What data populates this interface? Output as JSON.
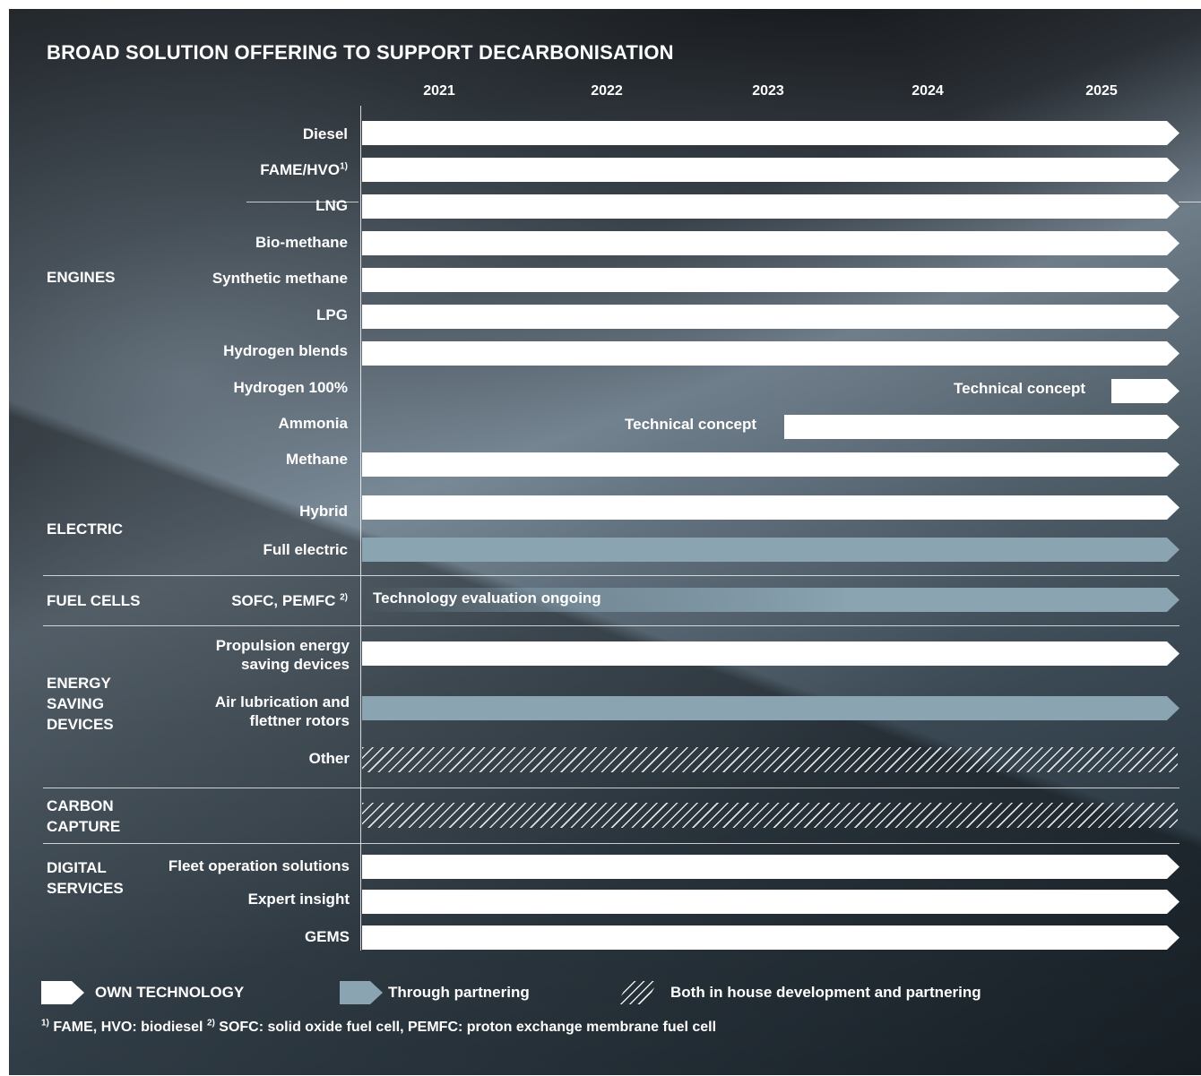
{
  "title": "BROAD SOLUTION OFFERING TO SUPPORT DECARBONISATION",
  "chart_data": {
    "type": "gantt",
    "title": "BROAD SOLUTION OFFERING TO SUPPORT DECARBONISATION",
    "x_axis": {
      "years": [
        "2021",
        "2022",
        "2023",
        "2024",
        "2025"
      ]
    },
    "categories": {
      "engines": "ENGINES",
      "electric": "ELECTRIC",
      "fuel_cells": "FUEL CELLS",
      "energy_saving": "ENERGY SAVING DEVICES",
      "carbon_capture": "CARBON CAPTURE",
      "digital": "DIGITAL SERVICES"
    },
    "rows": [
      {
        "group": "ENGINES",
        "label": "Diesel",
        "type": "own",
        "start": "2021",
        "end": "2025"
      },
      {
        "group": "ENGINES",
        "label": "FAME/HVO",
        "footnote": "1)",
        "type": "own",
        "start": "2021",
        "end": "2025"
      },
      {
        "group": "ENGINES",
        "label": "LNG",
        "type": "own",
        "start": "2021",
        "end": "2025"
      },
      {
        "group": "ENGINES",
        "label": "Bio-methane",
        "type": "own",
        "start": "2021",
        "end": "2025"
      },
      {
        "group": "ENGINES",
        "label": "Synthetic methane",
        "type": "own",
        "start": "2021",
        "end": "2025"
      },
      {
        "group": "ENGINES",
        "label": "LPG",
        "type": "own",
        "start": "2021",
        "end": "2025"
      },
      {
        "group": "ENGINES",
        "label": "Hydrogen blends",
        "type": "own",
        "start": "2021",
        "end": "2025"
      },
      {
        "group": "ENGINES",
        "label": "Hydrogen 100%",
        "type": "own",
        "start": "2025",
        "end": "2025",
        "note": "Technical concept"
      },
      {
        "group": "ENGINES",
        "label": "Ammonia",
        "type": "own",
        "start": "2023",
        "end": "2025",
        "note": "Technical concept"
      },
      {
        "group": "ENGINES",
        "label": "Methane",
        "type": "own",
        "start": "2021",
        "end": "2025"
      },
      {
        "group": "ELECTRIC",
        "label": "Hybrid",
        "type": "own",
        "start": "2021",
        "end": "2025"
      },
      {
        "group": "ELECTRIC",
        "label": "Full electric",
        "type": "partnering",
        "start": "2021",
        "end": "2025"
      },
      {
        "group": "FUEL CELLS",
        "label": "SOFC, PEMFC",
        "footnote": "2)",
        "type": "partnering",
        "start": "2021",
        "end": "2025",
        "note": "Technology evaluation ongoing"
      },
      {
        "group": "ENERGY SAVING DEVICES",
        "label": "Propulsion energy saving devices",
        "type": "own",
        "start": "2021",
        "end": "2025"
      },
      {
        "group": "ENERGY SAVING DEVICES",
        "label": "Air lubrication and flettner rotors",
        "type": "partnering",
        "start": "2021",
        "end": "2025"
      },
      {
        "group": "ENERGY SAVING DEVICES",
        "label": "Other",
        "type": "both",
        "start": "2021",
        "end": "2025"
      },
      {
        "group": "CARBON CAPTURE",
        "label": "",
        "type": "both",
        "start": "2021",
        "end": "2025"
      },
      {
        "group": "DIGITAL SERVICES",
        "label": "Fleet operation solutions",
        "type": "own",
        "start": "2021",
        "end": "2025"
      },
      {
        "group": "DIGITAL SERVICES",
        "label": "Expert insight",
        "type": "own",
        "start": "2021",
        "end": "2025"
      },
      {
        "group": "DIGITAL SERVICES",
        "label": "GEMS",
        "type": "own",
        "start": "2021",
        "end": "2025"
      }
    ],
    "legend": [
      {
        "type": "own",
        "label": "OWN TECHNOLOGY",
        "color": "#ffffff"
      },
      {
        "type": "partnering",
        "label": "Through partnering",
        "color": "#8aa4b2"
      },
      {
        "type": "both",
        "label": "Both in house development and partnering"
      }
    ]
  },
  "labels": {
    "cat_engines": "ENGINES",
    "cat_electric": "ELECTRIC",
    "cat_fuel_cells": "FUEL CELLS",
    "cat_energy_1": "ENERGY",
    "cat_energy_2": "SAVING",
    "cat_energy_3": "DEVICES",
    "cat_carbon_1": "CARBON",
    "cat_carbon_2": "CAPTURE",
    "cat_digital_1": "DIGITAL",
    "cat_digital_2": "SERVICES",
    "diesel": "Diesel",
    "fame": "FAME/HVO",
    "fame_sup": "1)",
    "lng": "LNG",
    "biomethane": "Bio-methane",
    "synmethane": "Synthetic methane",
    "lpg": "LPG",
    "h2blends": "Hydrogen blends",
    "h2full": "Hydrogen 100%",
    "ammonia": "Ammonia",
    "methane": "Methane",
    "hybrid": "Hybrid",
    "fullelectric": "Full electric",
    "sofc": "SOFC, PEMFC ",
    "sofc_sup": "2)",
    "prop_1": "Propulsion energy",
    "prop_2": "saving devices",
    "air_1": "Air lubrication and",
    "air_2": "flettner rotors",
    "other": "Other",
    "fleet": "Fleet operation solutions",
    "expert": "Expert insight",
    "gems": "GEMS",
    "tech_concept_h2": "Technical concept",
    "tech_concept_nh3": "Technical concept",
    "tech_eval": "Technology evaluation ongoing"
  },
  "legend": {
    "own": "OWN TECHNOLOGY",
    "partner": "Through partnering",
    "both": "Both in house development and partnering"
  },
  "footnote": {
    "sup1": "1)",
    "text1": " FAME, HVO: biodiesel ",
    "sup2": "2)",
    "text2": " SOFC: solid oxide fuel cell, PEMFC: proton exchange membrane fuel cell"
  },
  "colors": {
    "own": "#ffffff",
    "partnering": "#8aa4b2"
  }
}
